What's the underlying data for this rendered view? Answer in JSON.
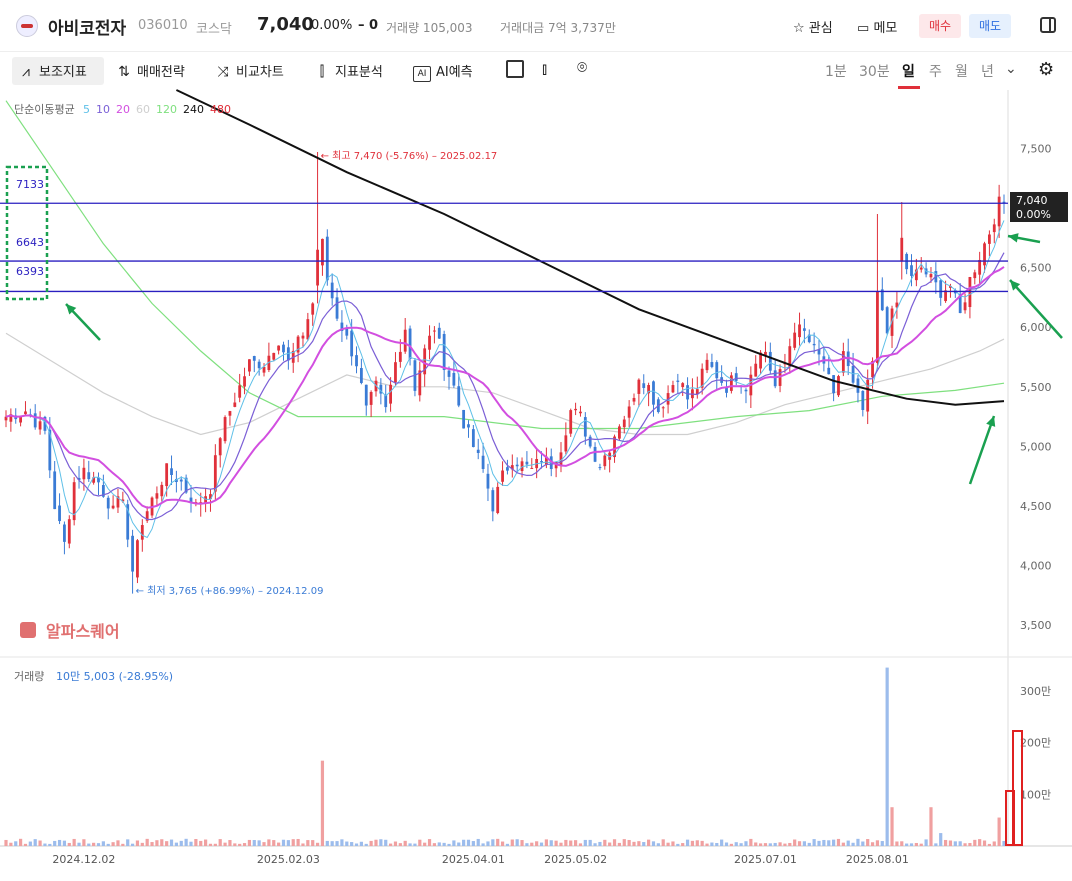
{
  "header": {
    "name": "아비코전자",
    "code": "036010",
    "market": "코스닥",
    "price": "7,040",
    "change_pct": "0.00%",
    "change_val": "0",
    "volume": "거래량 105,003",
    "amount": "거래대금 7억 3,737만",
    "fav_label": "관심",
    "memo_label": "메모",
    "buy_label": "매수",
    "sell_label": "매도"
  },
  "toolbar": {
    "indicator": "보조지표",
    "strategy": "매매전략",
    "compare": "비교차트",
    "analysis": "지표분석",
    "ai": "AI예측",
    "periods": [
      "1분",
      "30분",
      "일",
      "주",
      "월",
      "년"
    ],
    "selected_period": "일"
  },
  "colors": {
    "up": "#e0303a",
    "down": "#3a7bd5",
    "ma5": "#5fc0e8",
    "ma10": "#7b5fd6",
    "ma20": "#d24fe0",
    "ma60": "#cfcfcf",
    "ma120": "#7fe07f",
    "ma240": "#111111",
    "ma480": "#e0303a",
    "hline": "#2a1fc0",
    "arrow": "#1aa050"
  },
  "chart_data": {
    "type": "candlestick",
    "ma_legend": {
      "label": "단순이동평균",
      "periods": [
        "5",
        "10",
        "20",
        "60",
        "120",
        "240",
        "480"
      ]
    },
    "y_ticks": [
      "7,500",
      "7,000",
      "6,500",
      "6,000",
      "5,500",
      "5,000",
      "4,500",
      "4,000",
      "3,500"
    ],
    "y_tick_values": [
      7500,
      7000,
      6500,
      6000,
      5500,
      5000,
      4500,
      4000,
      3500
    ],
    "ylim": [
      3250,
      7990
    ],
    "x_ticks": [
      {
        "label": "2024.12.02",
        "index": 16
      },
      {
        "label": "2025.02.03",
        "index": 58
      },
      {
        "label": "2025.04.01",
        "index": 96
      },
      {
        "label": "2025.05.02",
        "index": 117
      },
      {
        "label": "2025.07.01",
        "index": 156
      },
      {
        "label": "2025.08.01",
        "index": 179
      }
    ],
    "high_annotation": "← 최고 7,470 (-5.76%) – 2025.02.17",
    "low_annotation": "← 최저 3,765 (+86.99%) – 2024.12.09",
    "horizontal_lines": [
      {
        "label": "7133",
        "value": 7040
      },
      {
        "label": "6643",
        "value": 6555
      },
      {
        "label": "6393",
        "value": 6300
      }
    ],
    "current_price_label": "7,040",
    "current_change_label": "0.00%",
    "watermark": "알파스퀘어",
    "volume_title": "거래량",
    "volume_value": "10만 5,003 (-28.95%)",
    "volume_ticks": [
      "300만",
      "200만",
      "100만"
    ],
    "volume_tick_values": [
      3000000,
      2000000,
      1000000
    ],
    "volume_max": 3500000,
    "key_closes": [
      [
        0,
        5250
      ],
      [
        4,
        5300
      ],
      [
        8,
        5120
      ],
      [
        10,
        4500
      ],
      [
        12,
        4180
      ],
      [
        14,
        4700
      ],
      [
        16,
        4800
      ],
      [
        19,
        4700
      ],
      [
        22,
        4450
      ],
      [
        24,
        4600
      ],
      [
        26,
        3850
      ],
      [
        27,
        4250
      ],
      [
        30,
        4550
      ],
      [
        33,
        4800
      ],
      [
        36,
        4700
      ],
      [
        39,
        4500
      ],
      [
        42,
        4650
      ],
      [
        44,
        5100
      ],
      [
        47,
        5400
      ],
      [
        50,
        5700
      ],
      [
        53,
        5700
      ],
      [
        56,
        5900
      ],
      [
        58,
        5700
      ],
      [
        61,
        5950
      ],
      [
        63,
        6200
      ],
      [
        64,
        6500
      ],
      [
        65,
        6700
      ],
      [
        66,
        6400
      ],
      [
        68,
        6100
      ],
      [
        70,
        5900
      ],
      [
        72,
        5700
      ],
      [
        74,
        5300
      ],
      [
        76,
        5500
      ],
      [
        78,
        5300
      ],
      [
        80,
        5700
      ],
      [
        82,
        6000
      ],
      [
        84,
        5500
      ],
      [
        86,
        5800
      ],
      [
        88,
        6000
      ],
      [
        90,
        5700
      ],
      [
        92,
        5500
      ],
      [
        94,
        5200
      ],
      [
        96,
        5000
      ],
      [
        98,
        4800
      ],
      [
        100,
        4500
      ],
      [
        102,
        4750
      ],
      [
        104,
        4900
      ],
      [
        106,
        4850
      ],
      [
        108,
        4800
      ],
      [
        110,
        4900
      ],
      [
        112,
        4850
      ],
      [
        114,
        5000
      ],
      [
        116,
        5300
      ],
      [
        118,
        5250
      ],
      [
        120,
        5000
      ],
      [
        122,
        4850
      ],
      [
        124,
        5000
      ],
      [
        126,
        5200
      ],
      [
        128,
        5300
      ],
      [
        130,
        5600
      ],
      [
        132,
        5500
      ],
      [
        134,
        5300
      ],
      [
        136,
        5450
      ],
      [
        138,
        5600
      ],
      [
        140,
        5400
      ],
      [
        142,
        5500
      ],
      [
        144,
        5700
      ],
      [
        146,
        5600
      ],
      [
        148,
        5500
      ],
      [
        150,
        5600
      ],
      [
        152,
        5500
      ],
      [
        154,
        5750
      ],
      [
        156,
        5800
      ],
      [
        158,
        5500
      ],
      [
        160,
        5700
      ],
      [
        162,
        6000
      ],
      [
        164,
        5950
      ],
      [
        166,
        5800
      ],
      [
        168,
        5700
      ],
      [
        170,
        5400
      ],
      [
        172,
        5800
      ],
      [
        174,
        5500
      ],
      [
        176,
        5300
      ],
      [
        178,
        5700
      ],
      [
        179,
        6300
      ],
      [
        181,
        6000
      ],
      [
        183,
        6200
      ],
      [
        184,
        6600
      ],
      [
        186,
        6400
      ],
      [
        188,
        6500
      ],
      [
        190,
        6400
      ],
      [
        192,
        6300
      ],
      [
        194,
        6350
      ],
      [
        196,
        6100
      ],
      [
        198,
        6400
      ],
      [
        200,
        6600
      ],
      [
        202,
        6800
      ],
      [
        204,
        7040
      ]
    ],
    "big_candles": [
      {
        "index": 64,
        "open": 6350,
        "close": 6650,
        "high": 7470,
        "low": 6200
      },
      {
        "index": 26,
        "open": 4250,
        "close": 3950,
        "high": 4300,
        "low": 3765
      },
      {
        "index": 179,
        "open": 5700,
        "close": 6300,
        "high": 6950,
        "low": 5650
      },
      {
        "index": 184,
        "open": 6550,
        "close": 6750,
        "high": 7050,
        "low": 6400
      }
    ],
    "ma240_points": [
      [
        35,
        7990
      ],
      [
        50,
        7700
      ],
      [
        70,
        7300
      ],
      [
        90,
        6950
      ],
      [
        110,
        6550
      ],
      [
        130,
        6150
      ],
      [
        150,
        5850
      ],
      [
        170,
        5550
      ],
      [
        185,
        5400
      ],
      [
        195,
        5350
      ],
      [
        205,
        5380
      ]
    ],
    "ma120_points": [
      [
        0,
        7900
      ],
      [
        10,
        7300
      ],
      [
        20,
        6700
      ],
      [
        30,
        6200
      ],
      [
        40,
        5800
      ],
      [
        50,
        5450
      ],
      [
        60,
        5250
      ],
      [
        75,
        5250
      ],
      [
        90,
        5250
      ],
      [
        110,
        5150
      ],
      [
        130,
        5150
      ],
      [
        150,
        5250
      ],
      [
        165,
        5300
      ],
      [
        180,
        5420
      ],
      [
        195,
        5470
      ],
      [
        205,
        5530
      ]
    ],
    "ma60_points": [
      [
        0,
        5950
      ],
      [
        10,
        5700
      ],
      [
        20,
        5450
      ],
      [
        30,
        5250
      ],
      [
        40,
        5100
      ],
      [
        50,
        5200
      ],
      [
        60,
        5400
      ],
      [
        70,
        5600
      ],
      [
        80,
        5500
      ],
      [
        90,
        5500
      ],
      [
        100,
        5450
      ],
      [
        110,
        5300
      ],
      [
        120,
        5150
      ],
      [
        130,
        5100
      ],
      [
        140,
        5100
      ],
      [
        150,
        5200
      ],
      [
        160,
        5350
      ],
      [
        170,
        5450
      ],
      [
        180,
        5550
      ],
      [
        190,
        5650
      ],
      [
        200,
        5800
      ],
      [
        205,
        5900
      ]
    ],
    "volume_key": [
      [
        65,
        1650000
      ],
      [
        181,
        3450000
      ],
      [
        182,
        750000
      ],
      [
        190,
        750000
      ],
      [
        192,
        250000
      ],
      [
        204,
        550000
      ]
    ]
  }
}
